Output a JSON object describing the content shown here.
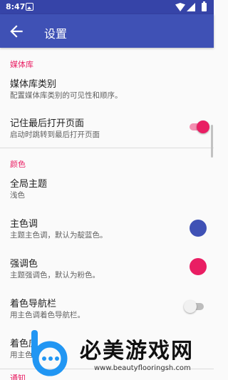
{
  "status_bar": {
    "time": "8:47"
  },
  "app_bar": {
    "title": "设置"
  },
  "sections": {
    "library": {
      "header": "媒体库",
      "media_categories": {
        "title": "媒体库类别",
        "summary": "配置媒体库类别的可见性和顺序。"
      },
      "remember_last_page": {
        "title": "记住最后打开页面",
        "summary": "启动时跳转到最后打开页面",
        "enabled": true
      }
    },
    "colors": {
      "header": "颜色",
      "theme": {
        "title": "全局主题",
        "summary": "浅色"
      },
      "primary_color": {
        "title": "主色调",
        "summary": "主题主色调，默认为靛蓝色。",
        "color": "#3f51b5"
      },
      "accent_color": {
        "title": "强调色",
        "summary": "主题强调色，默认为粉色。",
        "color": "#e91e63"
      },
      "colored_navbar": {
        "title": "着色导航栏",
        "summary": "用主色调着色导航栏。",
        "enabled": false
      },
      "colored_app_shortcuts": {
        "title": "着色应",
        "summary": "用主色"
      }
    },
    "notification": {
      "header": "通知"
    }
  },
  "watermark": {
    "title": "必美游戏网",
    "url": "www.beautyflooringsh.com"
  }
}
